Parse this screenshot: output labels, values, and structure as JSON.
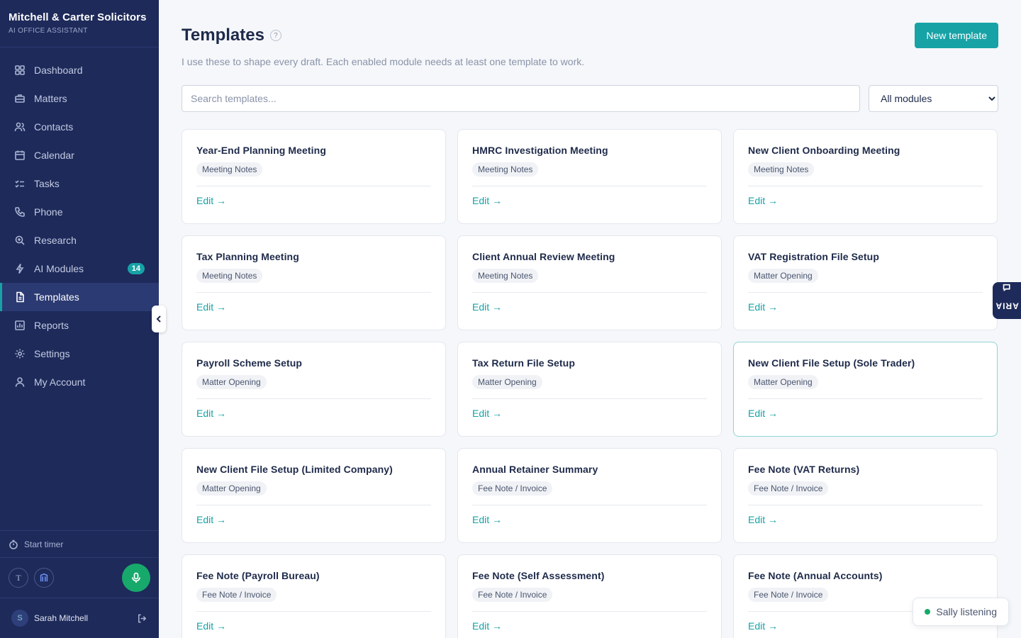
{
  "brand": {
    "name": "Mitchell & Carter Solicitors",
    "subtitle": "AI OFFICE ASSISTANT"
  },
  "nav": [
    {
      "label": "Dashboard",
      "icon": "dashboard-icon"
    },
    {
      "label": "Matters",
      "icon": "briefcase-icon"
    },
    {
      "label": "Contacts",
      "icon": "contacts-icon"
    },
    {
      "label": "Calendar",
      "icon": "calendar-icon"
    },
    {
      "label": "Tasks",
      "icon": "tasks-icon"
    },
    {
      "label": "Phone",
      "icon": "phone-icon"
    },
    {
      "label": "Research",
      "icon": "research-icon"
    },
    {
      "label": "AI Modules",
      "icon": "lightning-icon",
      "badge": "14"
    },
    {
      "label": "Templates",
      "icon": "document-icon",
      "active": true
    },
    {
      "label": "Reports",
      "icon": "reports-icon"
    },
    {
      "label": "Settings",
      "icon": "gear-icon"
    },
    {
      "label": "My Account",
      "icon": "user-icon"
    }
  ],
  "sidebar_bottom": {
    "timer_label": "Start timer",
    "tool_t": "T",
    "user_initial": "S",
    "user_name": "Sarah Mitchell"
  },
  "header": {
    "title": "Templates",
    "help": "?",
    "subtitle": "I use these to shape every draft. Each enabled module needs at least one template to work.",
    "new_button": "New template"
  },
  "search": {
    "placeholder": "Search templates..."
  },
  "filter": {
    "selected": "All modules"
  },
  "cards": [
    {
      "title": "Year-End Planning Meeting",
      "tag": "Meeting Notes",
      "edit": "Edit →"
    },
    {
      "title": "HMRC Investigation Meeting",
      "tag": "Meeting Notes",
      "edit": "Edit →"
    },
    {
      "title": "New Client Onboarding Meeting",
      "tag": "Meeting Notes",
      "edit": "Edit →"
    },
    {
      "title": "Tax Planning Meeting",
      "tag": "Meeting Notes",
      "edit": "Edit →"
    },
    {
      "title": "Client Annual Review Meeting",
      "tag": "Meeting Notes",
      "edit": "Edit →"
    },
    {
      "title": "VAT Registration File Setup",
      "tag": "Matter Opening",
      "edit": "Edit →"
    },
    {
      "title": "Payroll Scheme Setup",
      "tag": "Matter Opening",
      "edit": "Edit →"
    },
    {
      "title": "Tax Return File Setup",
      "tag": "Matter Opening",
      "edit": "Edit →"
    },
    {
      "title": "New Client File Setup (Sole Trader)",
      "tag": "Matter Opening",
      "edit": "Edit →"
    },
    {
      "title": "New Client File Setup (Limited Company)",
      "tag": "Matter Opening",
      "edit": "Edit →"
    },
    {
      "title": "Annual Retainer Summary",
      "tag": "Fee Note / Invoice",
      "edit": "Edit →"
    },
    {
      "title": "Fee Note (VAT Returns)",
      "tag": "Fee Note / Invoice",
      "edit": "Edit →"
    },
    {
      "title": "Fee Note (Payroll Bureau)",
      "tag": "Fee Note / Invoice",
      "edit": "Edit →"
    },
    {
      "title": "Fee Note (Self Assessment)",
      "tag": "Fee Note / Invoice",
      "edit": "Edit →"
    },
    {
      "title": "Fee Note (Annual Accounts)",
      "tag": "Fee Note / Invoice",
      "edit": "Edit →"
    }
  ],
  "aria_tab": {
    "label": "ARIA"
  },
  "sally": {
    "label": "Sally listening"
  },
  "colors": {
    "sidebar": "#1e2a5a",
    "accent": "#17a2a6",
    "mic": "#17a96b"
  }
}
